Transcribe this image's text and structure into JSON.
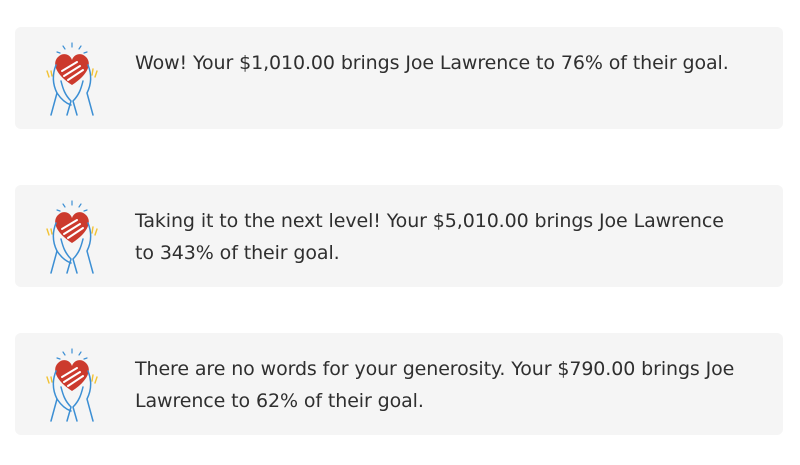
{
  "icon": {
    "name": "heart-in-hands-icon",
    "heart_color": "#cc3a2d",
    "line_color": "#3c8fd4",
    "spark_color": "#f2c233"
  },
  "cards": [
    {
      "message": "Wow! Your $1,010.00 brings Joe Lawrence to 76% of their goal."
    },
    {
      "message": "Taking it to the next level! Your $5,010.00 brings Joe Lawrence to 343% of their goal."
    },
    {
      "message": "There are no words for your generosity. Your $790.00 brings Joe Lawrence to 62% of their goal."
    }
  ]
}
